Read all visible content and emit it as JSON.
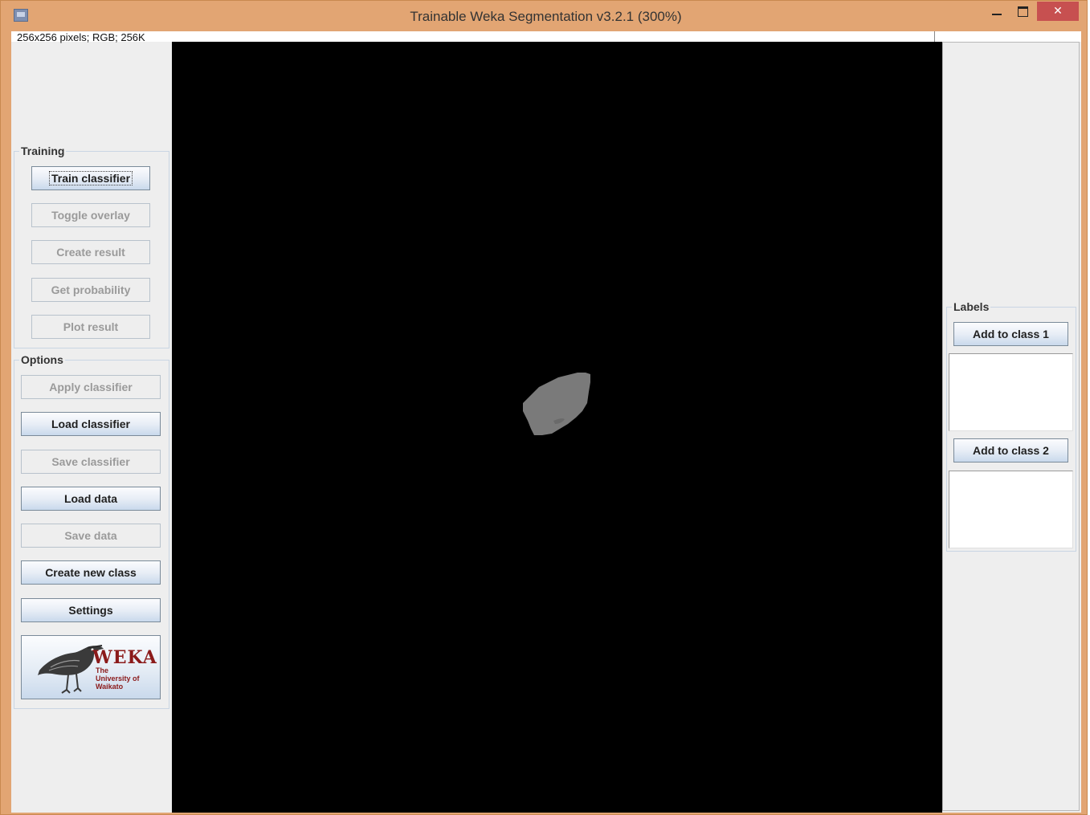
{
  "window": {
    "title": "Trainable Weka Segmentation v3.2.1 (300%)",
    "minimize_icon": "minimize-icon",
    "maximize_icon": "maximize-icon",
    "close_glyph": "✕"
  },
  "status": {
    "text": "256x256 pixels; RGB; 256K"
  },
  "training": {
    "label": "Training",
    "buttons": [
      {
        "label": "Train classifier",
        "enabled": true
      },
      {
        "label": "Toggle overlay",
        "enabled": false
      },
      {
        "label": "Create result",
        "enabled": false
      },
      {
        "label": "Get probability",
        "enabled": false
      },
      {
        "label": "Plot result",
        "enabled": false
      }
    ]
  },
  "options": {
    "label": "Options",
    "buttons": [
      {
        "label": "Apply classifier",
        "enabled": false
      },
      {
        "label": "Load classifier",
        "enabled": true
      },
      {
        "label": "Save classifier",
        "enabled": false
      },
      {
        "label": "Load data",
        "enabled": true
      },
      {
        "label": "Save data",
        "enabled": false
      },
      {
        "label": "Create new class",
        "enabled": true
      },
      {
        "label": "Settings",
        "enabled": true
      }
    ],
    "logo": {
      "word": "WEKA",
      "subtitle": "The University of Waikato"
    }
  },
  "labels": {
    "label": "Labels",
    "classes": [
      {
        "button": "Add to class 1"
      },
      {
        "button": "Add to class 2"
      }
    ]
  },
  "colors": {
    "window_frame": "#e2a573",
    "panel_bg": "#eeeeee",
    "canvas_bg": "#000000",
    "blob": "#7a7a7a",
    "close_button": "#c75050"
  }
}
